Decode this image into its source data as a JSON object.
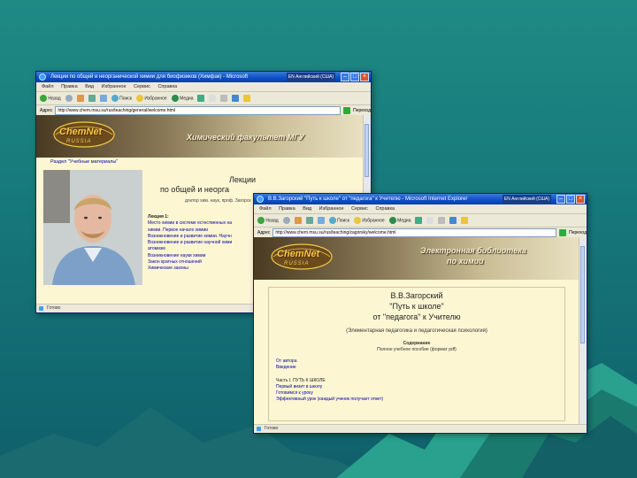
{
  "window1": {
    "title": "Лекции по общей и неорганической химии для биофизиков (Химфак) - Microsoft",
    "lang_indicator": "EN Английский (США)",
    "menu": [
      "Файл",
      "Правка",
      "Вид",
      "Избранное",
      "Сервис",
      "Справка"
    ],
    "toolbar": {
      "back": "Назад",
      "search": "Поиск",
      "favorites": "Избранное",
      "media": "Медиа"
    },
    "address_label": "Адрес",
    "address": "http://www.chem.msu.su/rus/teaching/general/welcome.html",
    "go_label": "Переход",
    "banner_title": "Химический факультет МГУ",
    "logo_text": "ChemNet",
    "logo_sub": "RUSSIA",
    "section_link": "Раздел \"Учебные материалы\"",
    "lecture_title_1": "Лекции",
    "lecture_title_2": "по общей и неорга",
    "author_line": "доктор хим. наук, проф. Загорск",
    "lecture_header": "Лекция 1:",
    "lecture_items": [
      "Место химии в системе естественных на",
      "химии. Первое начало химии",
      "Возникновение и развитие химии. Научн",
      "Возникновение и развитие научной хими",
      "атомизм",
      "Возникновение науки химии",
      "Закон кратных отношений",
      "Химические законы"
    ],
    "status": "Готово"
  },
  "window2": {
    "title": "В.В.Загорский \"Путь к школе\" от \"педагога\" к Учителю - Microsoft Internet Explorer",
    "lang_indicator": "EN Английский (США)",
    "menu": [
      "Файл",
      "Правка",
      "Вид",
      "Избранное",
      "Сервис",
      "Справка"
    ],
    "toolbar": {
      "back": "Назад",
      "search": "Поиск",
      "favorites": "Избранное",
      "media": "Медиа"
    },
    "address_label": "Адрес",
    "address": "http://www.chem.msu.su/rus/teaching/zagorsky/welcome.html",
    "go_label": "Переход",
    "banner_title_1": "Электронная библиотека",
    "banner_title_2": "по химии",
    "logo_text": "ChemNet",
    "logo_sub": "RUSSIA",
    "book_author": "В.В.Загорский",
    "book_title_1": "\"Путь к школе\"",
    "book_title_2": "от \"педагога\" к Учителю",
    "book_subtitle": "(Элементарная педагогика и педагогическая психология)",
    "contents_header": "Содержание",
    "contents_note": "Полное учебное пособие (формат pdf)",
    "links_top": [
      "От автора",
      "Введение"
    ],
    "part_header": "Часть I. ПУТЬ К ШКОЛЕ",
    "links": [
      "Первый визит в школу",
      "Готовимся к уроку",
      "Эффективный урок (каждый ученик получает ответ)"
    ],
    "status": "Готово"
  },
  "colors": {
    "slide_bg": "#1a8080",
    "titlebar": "#0a4ec8",
    "page_bg": "#fdf6d3",
    "link": "#0000aa",
    "logo": "#f2c94c"
  }
}
